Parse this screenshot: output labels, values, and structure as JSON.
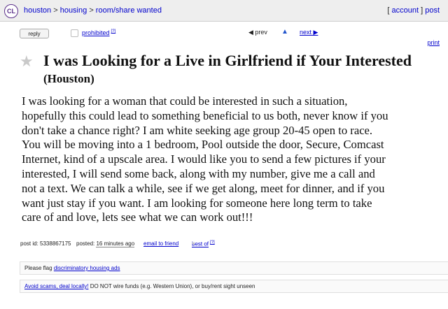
{
  "nav": {
    "logo": "CL",
    "crumbs": [
      "houston",
      "housing",
      "room/share wanted"
    ],
    "account_label": "account",
    "post_label": "post"
  },
  "toolbar": {
    "reply_label": "reply",
    "prohibited_label": "prohibited",
    "prohibited_sup": "[?]",
    "prev_label": "◀ prev",
    "up_label": "▲",
    "next_label": "next ▶",
    "print_label": "print"
  },
  "post": {
    "title": "I was Looking for a Live in Girlfriend if Your Interested",
    "location": "(Houston)",
    "body_lines": [
      "I was looking for a woman that could be interested in such a situation,",
      "hopefully this could lead to something beneficial to us both, never know if you",
      "don't take a chance right? I am white seeking age group 20-45 open to race.",
      "You will be moving into a 1 bedroom, Pool outside the door, Secure, Comcast",
      "Internet, kind of a upscale area. I would like you to send a few pictures if your",
      "interested, I will send some back, along with my number, give me a call and",
      "not a text. We can talk a while, see if we get along, meet for dinner, and if you",
      "want just stay if you want. I am looking for someone here long term to take",
      "care of and love, lets see what we can work out!!!"
    ]
  },
  "meta": {
    "post_id": "post id: 5338867175",
    "posted_label": "posted:",
    "posted_ago": "16 minutes ago",
    "email_friend": "email to friend",
    "best_of": "best of",
    "best_of_sup": "[?]"
  },
  "notices": {
    "flag_prefix": "Please flag",
    "flag_link": "discriminatory housing ads",
    "scam_link": "Avoid scams, deal locally!",
    "scam_text": "DO NOT wire funds (e.g. Western Union), or buy/rent sight unseen"
  }
}
